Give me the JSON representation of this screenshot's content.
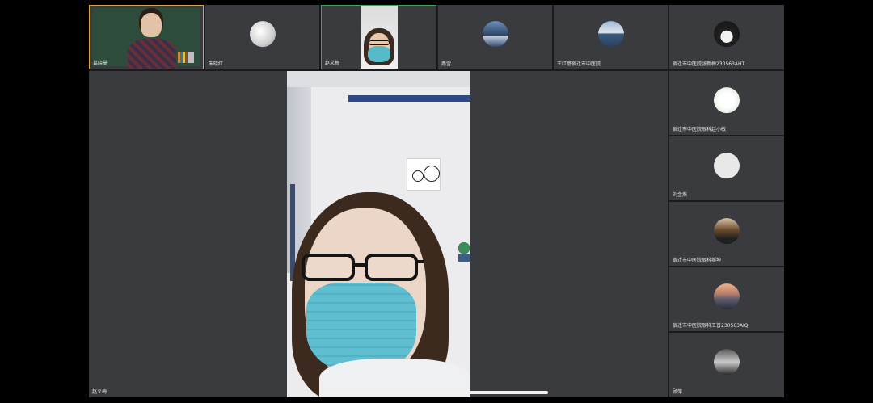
{
  "top_row": [
    {
      "label": "葛晓曼",
      "avatar": "teacher-video",
      "state": "speaking"
    },
    {
      "label": "朱晓红",
      "avatar": "sphere-icon"
    },
    {
      "label": "赵义梅",
      "avatar": "masked-face-video",
      "state": "active"
    },
    {
      "label": "燕雪",
      "avatar": "city-night-icon"
    },
    {
      "label": "王红意宿迁市中医院",
      "avatar": "sea-horizon-icon"
    },
    {
      "label": "宿迁市中医院张新梅230563AHT",
      "avatar": "coffee-cup-icon"
    }
  ],
  "side_column": [
    {
      "label": "宿迁市中医院眼科赵小敏",
      "avatar": "flower-icon"
    },
    {
      "label": "刘金燕",
      "avatar": "default-user-icon"
    },
    {
      "label": "宿迁市中医院眼科郝坤",
      "avatar": "person-photo-icon"
    },
    {
      "label": "宿迁市中医院眼科王普230563AIQ",
      "avatar": "sunset-icon"
    },
    {
      "label": "顾萍",
      "avatar": "dark-photo-icon"
    }
  ],
  "main_view": {
    "label": "赵义梅"
  }
}
